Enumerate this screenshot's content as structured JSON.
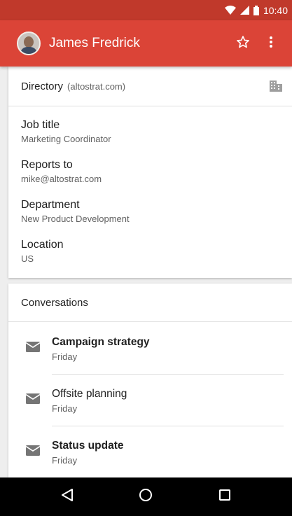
{
  "status_bar": {
    "time": "10:40",
    "icons": [
      "wifi-icon",
      "signal-icon",
      "battery-icon"
    ]
  },
  "app_bar": {
    "contact_name": "James Fredrick",
    "avatar": "avatar-icon",
    "actions": [
      "star-outline-icon",
      "more-vert-icon"
    ],
    "color": "#db4437"
  },
  "directory": {
    "label": "Directory",
    "domain": "(altostrat.com)",
    "icon": "building-icon",
    "fields": [
      {
        "title": "Job title",
        "value": "Marketing Coordinator"
      },
      {
        "title": "Reports to",
        "value": "mike@altostrat.com"
      },
      {
        "title": "Department",
        "value": "New Product Development"
      },
      {
        "title": "Location",
        "value": "US"
      }
    ]
  },
  "conversations": {
    "header": "Conversations",
    "items": [
      {
        "subject": "Campaign strategy",
        "date": "Friday",
        "unread": true,
        "icon": "mail-icon"
      },
      {
        "subject": "Offsite planning",
        "date": "Friday",
        "unread": false,
        "icon": "mail-icon"
      },
      {
        "subject": "Status update",
        "date": "Friday",
        "unread": true,
        "icon": "mail-icon"
      }
    ]
  },
  "nav_bar": {
    "buttons": [
      "back-icon",
      "home-icon",
      "recents-icon"
    ]
  }
}
